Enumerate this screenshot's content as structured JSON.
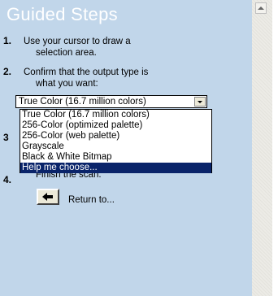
{
  "panel": {
    "title": "Guided Steps"
  },
  "steps": [
    {
      "num": "1.",
      "lines": [
        "Use your cursor to draw a",
        "selection area."
      ]
    },
    {
      "num": "2.",
      "lines": [
        "Confirm that the output type is",
        "what you want:"
      ]
    },
    {
      "num": "3",
      "lines": []
    },
    {
      "num": "4.",
      "lines": [
        "Finish the scan."
      ]
    }
  ],
  "output_type": {
    "selected": "True Color (16.7 million colors)",
    "options": [
      "True Color (16.7 million colors)",
      "256-Color (optimized palette)",
      "256-Color (web palette)",
      "Grayscale",
      "Black & White Bitmap",
      "Help me choose..."
    ],
    "highlighted_index": 5
  },
  "return": {
    "label": "Return to..."
  },
  "icons": {
    "back": "left-arrow-icon",
    "scroll_up": "scroll-up-arrow-icon"
  },
  "colors": {
    "panel_bg": "#c1d6ea",
    "title": "#ffffff",
    "highlight": "#0a246a"
  }
}
